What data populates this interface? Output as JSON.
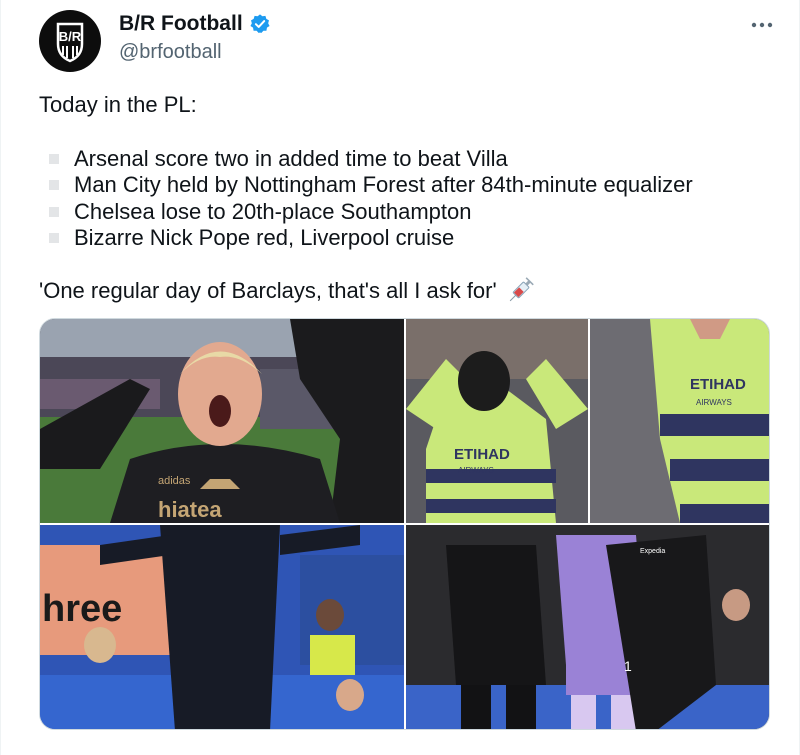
{
  "account": {
    "name": "B/R Football",
    "handle": "@brfootball",
    "avatar_text": "B/R",
    "verified_icon": "verified-badge-icon",
    "accent_color": "#1d9bf0"
  },
  "tweet": {
    "intro": "Today in the PL:",
    "bullets": [
      "Arsenal score two in added time to beat Villa",
      "Man City held by Nottingham Forest after 84th-minute equalizer",
      "Chelsea lose to 20th-place Southampton",
      "Bizarre Nick Pope red, Liverpool cruise"
    ],
    "quote": "'One regular day of Barclays, that's all I ask for'",
    "quote_emoji_icon": "syringe-icon"
  },
  "photos": {
    "photo1": {
      "shirt_text": "hiatea",
      "brand": "adidas"
    },
    "photo2": {
      "shirt_sponsor": "ETIHAD",
      "shirt_sub": "AIRWAYS"
    },
    "photo3": {
      "shirt_sponsor": "ETIHAD",
      "shirt_sub": "AIRWAYS"
    },
    "photo4": {
      "board_text": "hree"
    },
    "photo5": {
      "shirt_number": "1",
      "jacket_brand": "Expedia"
    }
  }
}
